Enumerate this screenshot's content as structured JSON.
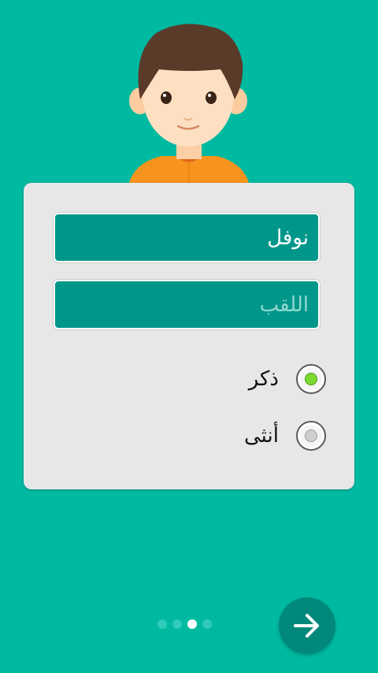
{
  "form": {
    "first_name_value": "نوفل",
    "last_name_placeholder": "اللقب"
  },
  "gender": {
    "options": [
      {
        "label": "ذكر",
        "selected": true
      },
      {
        "label": "أنثى",
        "selected": false
      }
    ]
  },
  "pager": {
    "pages": 4,
    "current": 3
  },
  "icons": {
    "avatar": "boy-avatar-icon",
    "next": "arrow-right-icon"
  },
  "colors": {
    "background": "#00b9a1",
    "field": "#00978a",
    "card": "#e7e7e7",
    "next_button": "#00897b",
    "radio_selected": "#7ad82f"
  }
}
